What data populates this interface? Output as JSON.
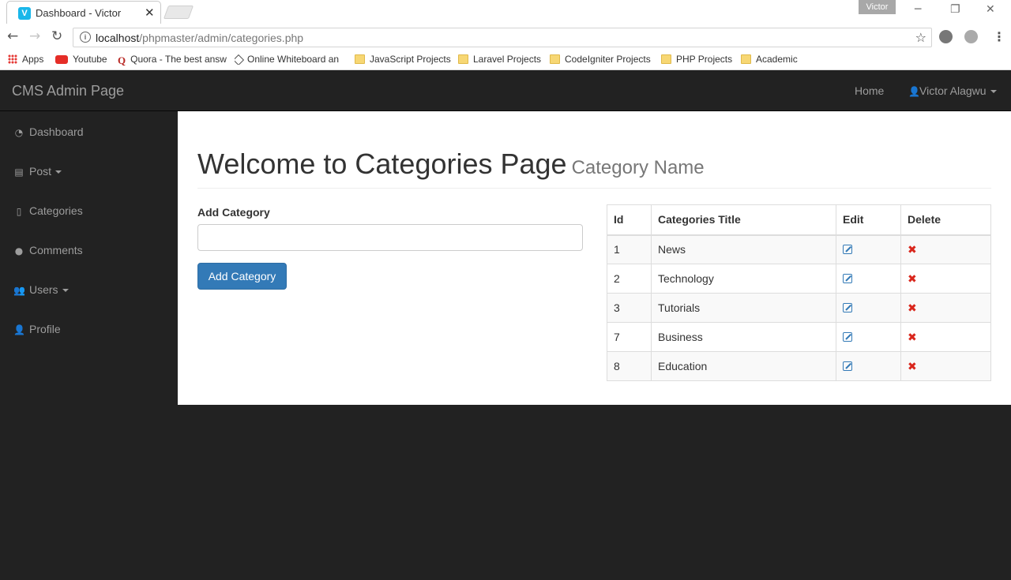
{
  "browser": {
    "tab_title": "Dashboard - Victor",
    "tab_favicon": "V",
    "profile_name": "Victor",
    "url_host": "localhost",
    "url_path": "/phpmaster/admin/categories.php",
    "bookmarks": [
      {
        "label": "Apps",
        "icon": "apps-icon"
      },
      {
        "label": "Youtube",
        "icon": "youtube-icon"
      },
      {
        "label": "Quora - The best answ",
        "icon": "quora-icon"
      },
      {
        "label": "Online Whiteboard an",
        "icon": "whiteboard-icon"
      },
      {
        "label": "JavaScript Projects",
        "icon": "folder-icon"
      },
      {
        "label": "Laravel Projects",
        "icon": "folder-icon"
      },
      {
        "label": "CodeIgniter Projects",
        "icon": "folder-icon"
      },
      {
        "label": "PHP Projects",
        "icon": "folder-icon"
      },
      {
        "label": "Academic",
        "icon": "folder-icon"
      }
    ]
  },
  "navbar": {
    "brand": "CMS Admin Page",
    "home": "Home",
    "user": "Victor Alagwu"
  },
  "sidebar": {
    "items": [
      {
        "label": "Dashboard",
        "icon": "dashboard-icon",
        "dropdown": false
      },
      {
        "label": "Post",
        "icon": "file-icon",
        "dropdown": true
      },
      {
        "label": "Categories",
        "icon": "file-icon",
        "dropdown": false
      },
      {
        "label": "Comments",
        "icon": "comments-icon",
        "dropdown": false
      },
      {
        "label": "Users",
        "icon": "users-icon",
        "dropdown": true
      },
      {
        "label": "Profile",
        "icon": "user-icon",
        "dropdown": false
      }
    ]
  },
  "page": {
    "title": "Welcome to Categories Page",
    "subtitle": "Category Name",
    "form": {
      "label": "Add Category",
      "input_value": "",
      "button": "Add Category"
    },
    "table": {
      "headers": [
        "Id",
        "Categories Title",
        "Edit",
        "Delete"
      ],
      "rows": [
        {
          "id": "1",
          "title": "News"
        },
        {
          "id": "2",
          "title": "Technology"
        },
        {
          "id": "3",
          "title": "Tutorials"
        },
        {
          "id": "7",
          "title": "Business"
        },
        {
          "id": "8",
          "title": "Education"
        }
      ]
    }
  },
  "colors": {
    "navbar_bg": "#222222",
    "primary": "#337ab7",
    "delete": "#d9261c"
  }
}
